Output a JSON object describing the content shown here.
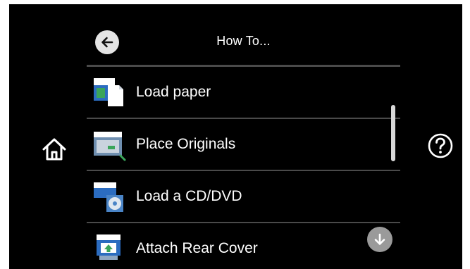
{
  "header": {
    "title": "How To...",
    "back_icon": "arrow-left-icon"
  },
  "side": {
    "home_icon": "home-icon",
    "help_icon": "question-circle-icon"
  },
  "items": [
    {
      "label": "Load paper",
      "icon": "load-paper-icon"
    },
    {
      "label": "Place Originals",
      "icon": "place-originals-icon"
    },
    {
      "label": "Load a CD/DVD",
      "icon": "load-cd-dvd-icon"
    },
    {
      "label": "Attach Rear Cover",
      "icon": "attach-rear-cover-icon"
    }
  ],
  "scroll": {
    "down_icon": "arrow-down-icon"
  },
  "colors": {
    "background": "#000000",
    "text": "#ffffff",
    "divider": "#4a4a4a",
    "icon_blue": "#2b6cc0",
    "icon_green": "#3aa55a"
  }
}
